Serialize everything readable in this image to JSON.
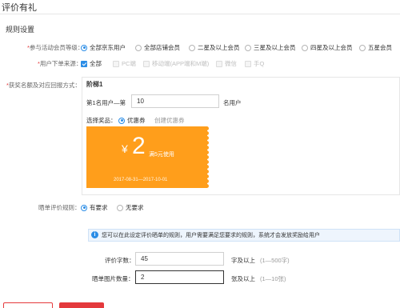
{
  "header": {
    "title": "评价有礼"
  },
  "section": {
    "title": "规则设置"
  },
  "member_level": {
    "label": "*参与活动会员等级：",
    "options": [
      "全部京东用户",
      "全部店铺会员",
      "二星及以上会员",
      "三星及以上会员",
      "四星及以上会员",
      "五星会员"
    ],
    "selected_index": 0
  },
  "order_source": {
    "label": "*用户下单来源：",
    "options": [
      {
        "label": "全部",
        "checked": true,
        "disabled": false
      },
      {
        "label": "PC端",
        "checked": false,
        "disabled": true
      },
      {
        "label": "移动端(APP端和M端)",
        "checked": false,
        "disabled": true
      },
      {
        "label": "微信",
        "checked": false,
        "disabled": true
      },
      {
        "label": "手Q",
        "checked": false,
        "disabled": true
      }
    ]
  },
  "reward": {
    "label": "*获奖名额及对应回报方式：",
    "tier_title": "阶梯1",
    "rank_prefix": "第1名用户—第",
    "rank_value": "10",
    "rank_suffix": "名用户",
    "gift_label": "选择奖品：",
    "gift_selected": "优惠券",
    "gift_create_link": "创建优惠券",
    "coupon": {
      "currency": "¥",
      "amount": "2",
      "condition": "满5元使用",
      "date_range": "2017-08-31—2017-10-01",
      "color": "#ff9e1b"
    }
  },
  "review_rule": {
    "label": "晒单评价规则：",
    "options": [
      "有要求",
      "无要求"
    ],
    "selected_index": 0,
    "notice": "您可以在此设定评价晒单的规则，用户需要满足您要求的规则，系统才会发放奖励给用户",
    "word_count_label": "评价字数：",
    "word_count_value": "45",
    "word_count_suffix": "字及以上",
    "word_count_hint": "(1—500字)",
    "image_count_label": "晒单图片数量：",
    "image_count_value": "2",
    "image_count_suffix": "张及以上",
    "image_count_hint": "(1—10张)"
  },
  "colors": {
    "accent": "#2b8de6",
    "danger": "#e4393c",
    "coupon": "#ff9e1b"
  }
}
